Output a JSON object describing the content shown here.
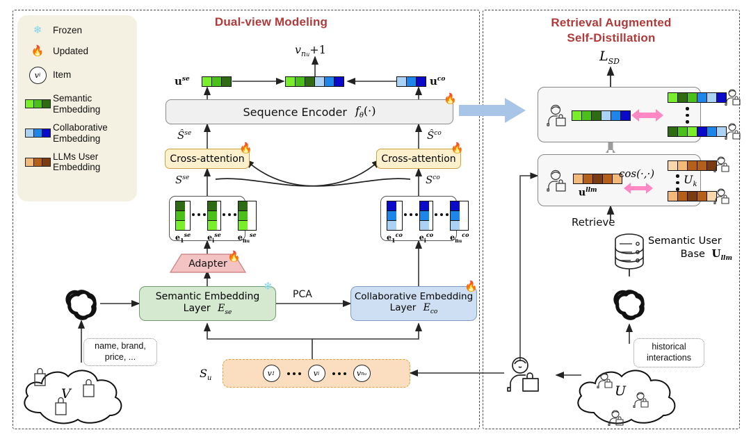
{
  "panels": {
    "left": {
      "title": "Dual-view Modeling"
    },
    "right": {
      "title_line1": "Retrieval Augmented",
      "title_line2": "Self-Distillation"
    }
  },
  "colors": {
    "title_red": "#b03a3a",
    "semantic_greens": [
      "#7aee2a",
      "#4cc01a",
      "#2f6b12"
    ],
    "collab_blues": [
      "#a9d2f5",
      "#1e86e8",
      "#0a0ac8"
    ],
    "llm_oranges": [
      "#f3b978",
      "#b5601a",
      "#7a3c10"
    ],
    "legend_bg": "#f5f1e2",
    "semantic_layer_bg": "#d5e8d0",
    "collab_layer_bg": "#cfdff3",
    "cross_attn_bg": "#fdf0cd",
    "adapter_bg": "#f3c3c3",
    "sequence_bg": "#f0f0f0",
    "sequence_orange_bg": "#fbddc0",
    "big_arrow": "#a8c4e6",
    "pink_arrow": "#ff87c4"
  },
  "legend": {
    "items": [
      {
        "icon": "snowflake-icon",
        "label": "Frozen"
      },
      {
        "icon": "flame-icon",
        "label": "Updated"
      },
      {
        "icon": "item-circle-icon",
        "label": "Item",
        "symbol": "v",
        "sub": "i"
      },
      {
        "icon": "semantic-swatch-icon",
        "label": "Semantic\nEmbedding",
        "label_l1": "Semantic",
        "label_l2": "Embedding"
      },
      {
        "icon": "collaborative-swatch-icon",
        "label_l1": "Collaborative",
        "label_l2": "Embedding"
      },
      {
        "icon": "llm-user-swatch-icon",
        "label_l1": "LLMs User",
        "label_l2": "Embedding"
      }
    ]
  },
  "left_panel": {
    "next_item_label": "v",
    "next_item_sub": "n",
    "next_item_sub2": "u",
    "next_item_plus": "+1",
    "u_se": "u",
    "u_se_sup": "se",
    "u_co": "u",
    "u_co_sup": "co",
    "sequence_encoder": "Sequence Encoder",
    "sequence_encoder_fn": "f",
    "sequence_encoder_fn_sub": "θ",
    "sequence_encoder_fn_arg": "(·)",
    "s_hat_se": "Ŝ",
    "s_hat_se_sup": "se",
    "s_hat_co": "Ŝ",
    "s_hat_co_sup": "co",
    "cross_attention_left": "Cross-attention",
    "cross_attention_right": "Cross-attention",
    "s_se": "S",
    "s_se_sup": "se",
    "s_co": "S",
    "s_co_sup": "co",
    "emb_se": [
      {
        "base": "e",
        "sub": "1",
        "sup": "se"
      },
      {
        "base": "e",
        "sub": "i",
        "sup": "se"
      },
      {
        "base": "e",
        "sub": "n",
        "sub2": "u",
        "sup": "se"
      }
    ],
    "emb_co": [
      {
        "base": "e",
        "sub": "1",
        "sup": "co"
      },
      {
        "base": "e",
        "sub": "i",
        "sup": "co"
      },
      {
        "base": "e",
        "sub": "n",
        "sub2": "u",
        "sup": "co"
      }
    ],
    "adapter": "Adapter",
    "semantic_layer_l1": "Semantic Embedding",
    "semantic_layer_l2": "Layer",
    "semantic_layer_sym": "E",
    "semantic_layer_sub": "se",
    "collab_layer_l1": "Collaborative Embedding",
    "collab_layer_l2": "Layer",
    "collab_layer_sym": "E",
    "collab_layer_sub": "co",
    "pca_label": "PCA",
    "sequence_label": "S",
    "sequence_label_sub": "u",
    "seq_items": [
      {
        "base": "v",
        "sub": "1"
      },
      {
        "base": "v",
        "sub": "i"
      },
      {
        "base": "v",
        "sub": "n",
        "sub2": "u"
      }
    ],
    "item_attrs_callout": "name, brand,\nprice, ...",
    "item_attrs_l1": "name, brand,",
    "item_attrs_l2": "price, ...",
    "item_cloud_symbol": "V"
  },
  "right_panel": {
    "loss_label": "L",
    "loss_sub": "SD",
    "cos_label": "cos(·,·)",
    "u_llm": "u",
    "u_llm_sup": "llm",
    "u_k_label": "U",
    "u_k_sub": "k",
    "retrieve_label": "Retrieve",
    "semantic_user_base_l1": "Semantic User",
    "semantic_user_base_l2": "Base",
    "semantic_user_base_sym": "U",
    "semantic_user_base_sub": "llm",
    "historical_callout_l1": "historical",
    "historical_callout_l2": "interactions",
    "user_cloud_symbol": "U"
  },
  "vectors": {
    "u_se_cells": [
      "#7aee2a",
      "#4cc01a",
      "#2f6b12"
    ],
    "u_co_cells": [
      "#a9d2f5",
      "#1e86e8",
      "#0a0ac8"
    ],
    "fused_cells": [
      "#7aee2a",
      "#4cc01a",
      "#2f6b12",
      "#a9d2f5",
      "#1e86e8",
      "#0a0ac8"
    ],
    "student_cells": [
      "#7aee2a",
      "#4cc01a",
      "#2f6b12",
      "#a9d2f5",
      "#1e86e8",
      "#0a0ac8"
    ],
    "teacher_top_cells": [
      "#7aee2a",
      "#2f6b12",
      "#4cc01a",
      "#1e86e8",
      "#a9d2f5",
      "#0a0ac8"
    ],
    "teacher_bottom_cells": [
      "#2f6b12",
      "#4cc01a",
      "#7aee2a",
      "#0a0ac8",
      "#1e86e8",
      "#a9d2f5"
    ],
    "u_llm_cells": [
      "#f3b978",
      "#b5601a",
      "#7a3c10",
      "#b5601a",
      "#f3b978"
    ],
    "cand_top_cells": [
      "#f8d7ad",
      "#f3b978",
      "#b5601a",
      "#b5601a",
      "#7a3c10"
    ],
    "cand_bottom_cells": [
      "#f3b978",
      "#b5601a",
      "#7a3c10",
      "#b5601a",
      "#f8d7ad"
    ],
    "emb_se_col": [
      "#2f6b12",
      "#4cc01a",
      "#7aee2a"
    ],
    "emb_co_col": [
      "#0a0ac8",
      "#1e86e8",
      "#a9d2f5"
    ]
  }
}
